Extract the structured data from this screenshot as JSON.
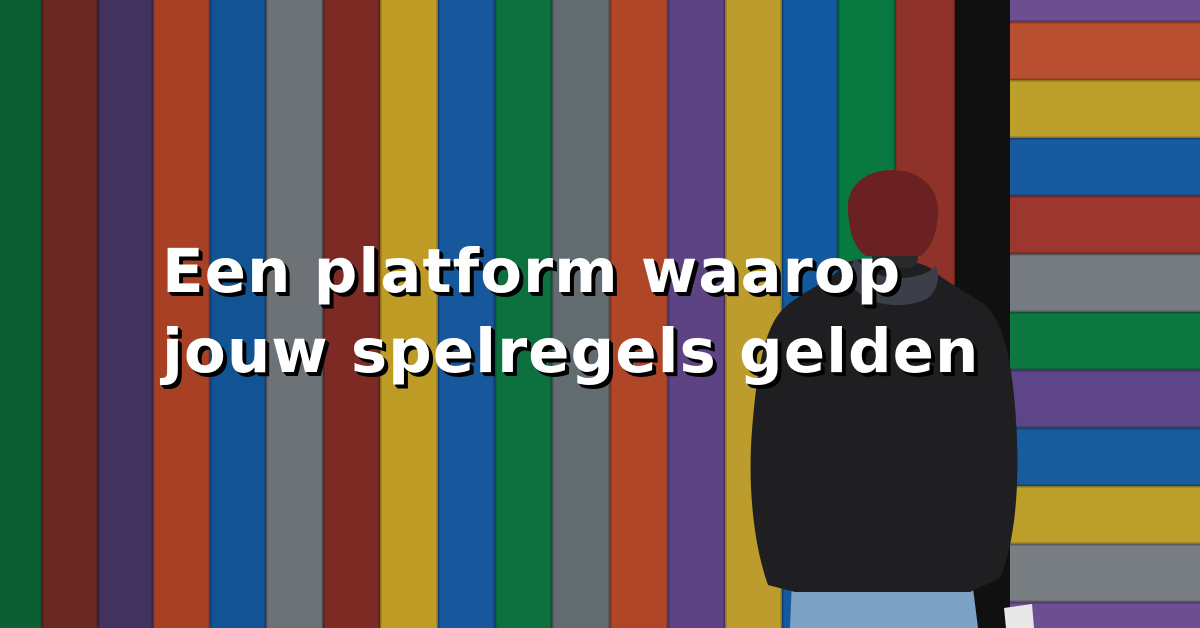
{
  "banner": {
    "headline_lines": [
      "Een platform waarop",
      "jouw spelregels gelden"
    ]
  },
  "photo": {
    "vertical_stripe_colors": [
      "#0e6d3c",
      "#7a2e27",
      "#4b3a6b",
      "#c0492c",
      "#1560a8",
      "#7d8288",
      "#8f2f2a",
      "#d8b12a",
      "#1b63b2",
      "#0f8048",
      "#6f7a80",
      "#c8502e",
      "#6a4d97",
      "#d7b233",
      "#1566b5",
      "#0b8a4c",
      "#a23a30",
      "#131313"
    ],
    "horizontal_stripe_colors": [
      "#7b5aa6",
      "#d25b37",
      "#d8b532",
      "#1b67b6",
      "#b13f35",
      "#868c93",
      "#0f8a4b",
      "#6c4f9a",
      "#1c69b3",
      "#d7b431",
      "#8a9096"
    ],
    "person_colors": {
      "beanie": "#6b2121",
      "jacket": "#1f1f21",
      "jeans": "#7ea2c4"
    }
  }
}
